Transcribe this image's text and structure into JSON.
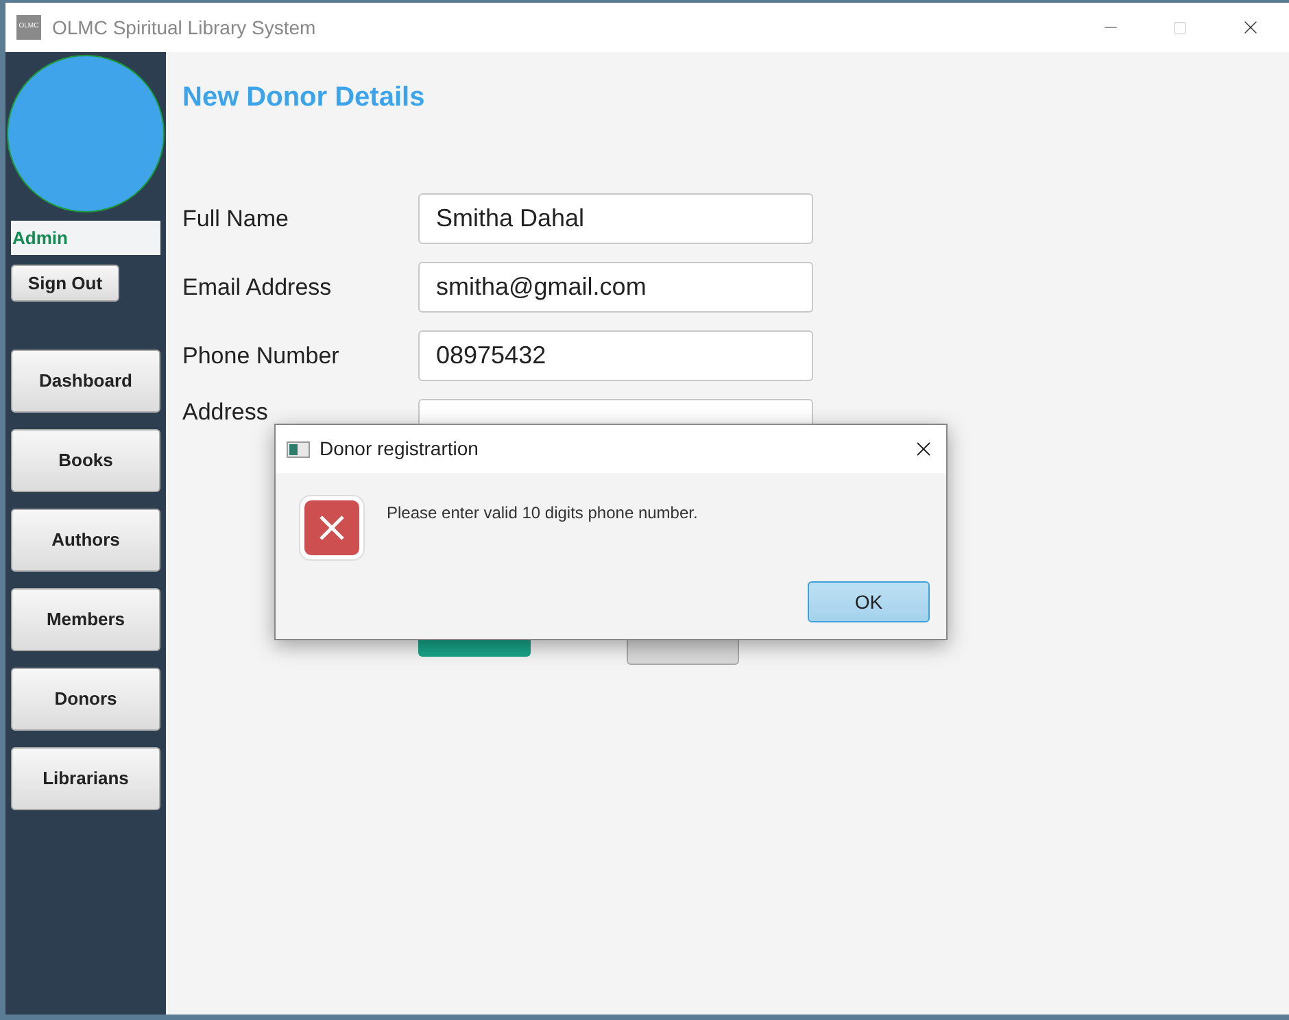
{
  "window": {
    "title": "OLMC Spiritual Library System",
    "logo": "OLMC"
  },
  "sidebar": {
    "user": "Admin",
    "sign_out": "Sign Out",
    "nav": [
      {
        "label": "Dashboard"
      },
      {
        "label": "Books"
      },
      {
        "label": "Authors"
      },
      {
        "label": "Members"
      },
      {
        "label": "Donors"
      },
      {
        "label": "Librarians"
      }
    ]
  },
  "form": {
    "heading": "New Donor Details",
    "fields": [
      {
        "label": "Full Name",
        "value": "Smitha Dahal"
      },
      {
        "label": "Email Address",
        "value": "smitha@gmail.com"
      },
      {
        "label": "Phone Number",
        "value": "08975432"
      },
      {
        "label": "Address"
      }
    ],
    "buttons": [
      {
        "kind": "primary"
      },
      {
        "kind": "secondary"
      }
    ]
  },
  "dialog": {
    "title": "Donor registrartion",
    "message": "Please enter valid 10 digits phone number.",
    "ok": "OK"
  }
}
